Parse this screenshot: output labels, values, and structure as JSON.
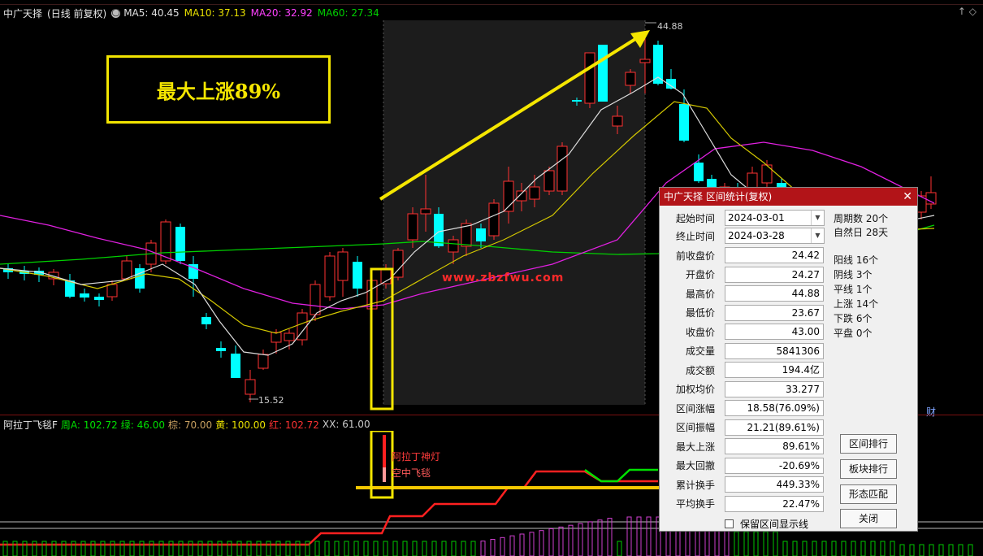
{
  "header": {
    "stock_title": "中广天择",
    "period": "(日线 前复权)",
    "settings_icon": "circle-o-icon",
    "ma5": "MA5: 40.45",
    "ma10": "MA10: 37.13",
    "ma20": "MA20: 32.92",
    "ma60": "MA60: 27.34",
    "corner_icons": "↑ ◇"
  },
  "colors": {
    "ma5": "#e0e0e0",
    "ma10": "#e8e000",
    "ma20": "#ff40ff",
    "ma60": "#00d000",
    "up": "#ff3232",
    "down": "#00ffff",
    "accent": "#b21418",
    "annotation": "#f5e600"
  },
  "chart": {
    "annotation": "最大上涨89%",
    "peak_label": "44.88",
    "low_label": "15.52",
    "watermark": "www.zbzfwu.com",
    "finance_tag": "财"
  },
  "indicator": {
    "name": "阿拉丁飞毯F",
    "zhou": "周A: 102.72",
    "lv": "绿: 46.00",
    "zong": "棕: 70.00",
    "huang": "黄: 100.00",
    "hong": "红: 102.72",
    "xx": "XX: 61.00",
    "signal1": "阿拉丁神灯",
    "signal2": "空中飞毯"
  },
  "dialog": {
    "title": "中广天择 区间统计(复权)",
    "close_icon": "close-icon",
    "start_label": "起始时间",
    "start_value": "2024-03-01",
    "end_label": "终止时间",
    "end_value": "2024-03-28",
    "stats": [
      {
        "label": "前收盘价",
        "value": "24.42"
      },
      {
        "label": "开盘价",
        "value": "24.27"
      },
      {
        "label": "最高价",
        "value": "44.88"
      },
      {
        "label": "最低价",
        "value": "23.67"
      },
      {
        "label": "收盘价",
        "value": "43.00"
      },
      {
        "label": "成交量",
        "value": "5841306"
      },
      {
        "label": "成交额",
        "value": "194.4亿"
      },
      {
        "label": "加权均价",
        "value": "33.277"
      },
      {
        "label": "区间涨幅",
        "value": "18.58(76.09%)"
      },
      {
        "label": "区间振幅",
        "value": "21.21(89.61%)"
      },
      {
        "label": "最大上涨",
        "value": "89.61%"
      },
      {
        "label": "最大回撤",
        "value": "-20.69%"
      },
      {
        "label": "累计换手",
        "value": "449.33%"
      },
      {
        "label": "平均换手",
        "value": "22.47%"
      }
    ],
    "side": {
      "zhouqi": "周期数 20个",
      "ziran": "自然日 28天",
      "yang": "阳线 16个",
      "yin": "阴线 3个",
      "ping": "平线 1个",
      "up": "上涨 14个",
      "down": "下跌 6个",
      "flat": "平盘 0个"
    },
    "buttons": {
      "rank": "区间排行",
      "sector": "板块排行",
      "pattern": "形态匹配",
      "close": "关闭"
    },
    "checkbox_label": "保留区间显示线"
  }
}
